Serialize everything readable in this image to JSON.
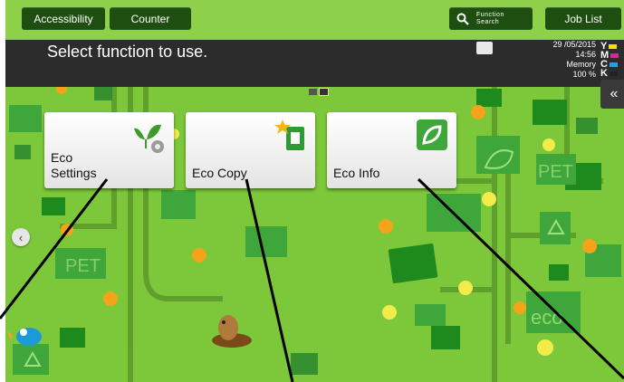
{
  "topbar": {
    "accessibility_label": "Accessibility",
    "counter_label": "Counter",
    "function_search_label_line1": "Function",
    "function_search_label_line2": "Search",
    "job_list_label": "Job List"
  },
  "message": {
    "text": "Select function to use."
  },
  "status": {
    "date": "29 /05/2015",
    "time": "14:56",
    "memory_label": "Memory",
    "memory_value": "100 %"
  },
  "toner": [
    {
      "letter": "Y",
      "color": "#f2e600"
    },
    {
      "letter": "M",
      "color": "#e0249a"
    },
    {
      "letter": "C",
      "color": "#19a3e8"
    },
    {
      "letter": "K",
      "color": "#222222"
    }
  ],
  "tiles": [
    {
      "line1": "Eco",
      "line2": "Settings",
      "icon": "eco-settings-icon"
    },
    {
      "line1": "Eco Copy",
      "icon": "eco-copy-icon"
    },
    {
      "line1": "Eco Info",
      "icon": "eco-info-icon"
    }
  ],
  "background": {
    "pet_label": "PET",
    "eco_label": "eco"
  },
  "colors": {
    "background_green": "#7cc73a",
    "button_dark_green": "#1f4f10",
    "message_bar": "#2c2c2c"
  }
}
